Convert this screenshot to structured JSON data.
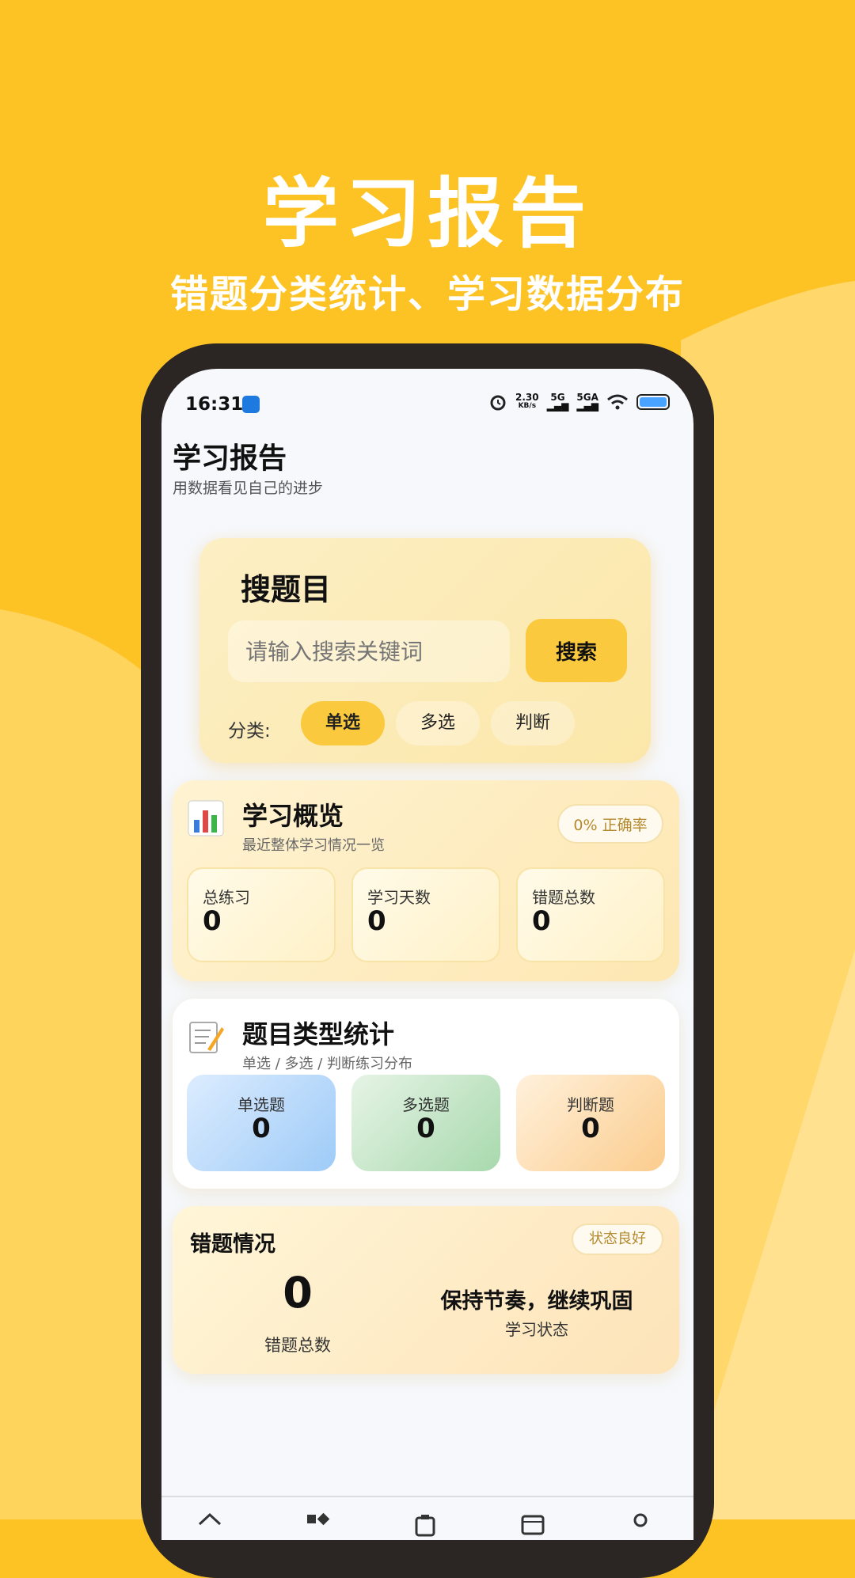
{
  "promo": {
    "title": "学习报告",
    "subtitle": "错题分类统计、学习数据分布"
  },
  "status_bar": {
    "time": "16:31",
    "net_speed": "2.30",
    "net_unit": "KB/s",
    "sim1": "5G",
    "sim2": "5GA"
  },
  "page": {
    "title": "学习报告",
    "subtitle": "用数据看见自己的进步"
  },
  "search": {
    "title": "搜题目",
    "placeholder": "请输入搜索关键词",
    "button": "搜索",
    "category_label": "分类:",
    "categories": [
      "单选",
      "多选",
      "判断"
    ],
    "active_category": "单选"
  },
  "overview": {
    "title": "学习概览",
    "subtitle": "最近整体学习情况一览",
    "accuracy_badge": "0% 正确率",
    "stats": [
      {
        "label": "总练习",
        "value": "0"
      },
      {
        "label": "学习天数",
        "value": "0"
      },
      {
        "label": "错题总数",
        "value": "0"
      }
    ]
  },
  "types": {
    "title": "题目类型统计",
    "subtitle": "单选 / 多选 / 判断练习分布",
    "stats": [
      {
        "label": "单选题",
        "value": "0"
      },
      {
        "label": "多选题",
        "value": "0"
      },
      {
        "label": "判断题",
        "value": "0"
      }
    ]
  },
  "wrong": {
    "title": "错题情况",
    "badge": "状态良好",
    "count": "0",
    "count_label": "错题总数",
    "state": "保持节奏，继续巩固",
    "state_label": "学习状态"
  },
  "icons": {
    "overview": "bar-chart-icon",
    "types": "memo-icon",
    "tabs": [
      "home-icon",
      "category-icon",
      "clipboard-icon",
      "calendar-icon",
      "profile-icon"
    ]
  },
  "colors": {
    "brand_yellow": "#fdc325",
    "accent": "#fbc93d"
  }
}
